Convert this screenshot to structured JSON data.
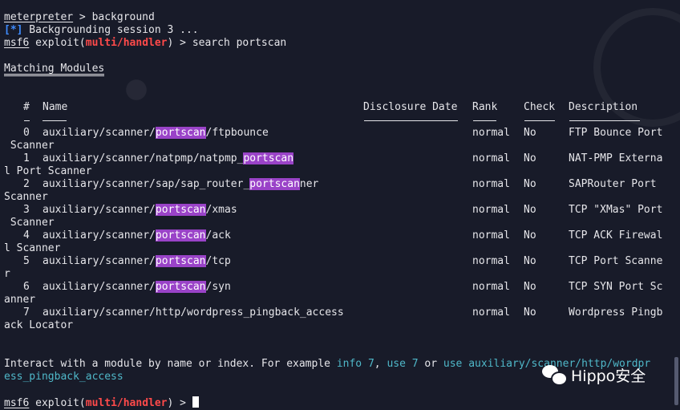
{
  "colors": {
    "background": "#181b29",
    "highlight": "#9a43c8",
    "red": "#ff4a4a",
    "blue": "#3f8cff",
    "cyan": "#4fb8c9"
  },
  "lines": {
    "l1_prompt": "meterpreter",
    "l1_cmd": " > background",
    "l2_marker": "[*]",
    "l2_text": " Backgrounding session 3 ...",
    "l3_prompt": "msf6",
    "l3_a": " exploit(",
    "l3_module": "multi/handler",
    "l3_b": ") > search portscan",
    "matching": "Matching Modules"
  },
  "table": {
    "headers": {
      "num": "#",
      "name": "Name",
      "date": "Disclosure Date",
      "rank": "Rank",
      "check": "Check",
      "desc": "Description"
    },
    "rows": [
      {
        "num": "0",
        "pre": "auxiliary/scanner/",
        "hl": "portscan",
        "post": "/ftpbounce",
        "rank": "normal",
        "check": "No",
        "desc": "FTP Bounce Port",
        "wrap": " Scanner"
      },
      {
        "num": "1",
        "pre": "auxiliary/scanner/natpmp/natpmp_",
        "hl": "portscan",
        "post": "",
        "rank": "normal",
        "check": "No",
        "desc": "NAT-PMP Externa",
        "wrap": "l Port Scanner"
      },
      {
        "num": "2",
        "pre": "auxiliary/scanner/sap/sap_router_",
        "hl": "portscan",
        "post": "ner",
        "rank": "normal",
        "check": "No",
        "desc": "SAPRouter Port",
        "wrap": "Scanner"
      },
      {
        "num": "3",
        "pre": "auxiliary/scanner/",
        "hl": "portscan",
        "post": "/xmas",
        "rank": "normal",
        "check": "No",
        "desc": "TCP \"XMas\" Port",
        "wrap": " Scanner"
      },
      {
        "num": "4",
        "pre": "auxiliary/scanner/",
        "hl": "portscan",
        "post": "/ack",
        "rank": "normal",
        "check": "No",
        "desc": "TCP ACK Firewal",
        "wrap": "l Scanner"
      },
      {
        "num": "5",
        "pre": "auxiliary/scanner/",
        "hl": "portscan",
        "post": "/tcp",
        "rank": "normal",
        "check": "No",
        "desc": "TCP Port Scanne",
        "wrap": "r"
      },
      {
        "num": "6",
        "pre": "auxiliary/scanner/",
        "hl": "portscan",
        "post": "/syn",
        "rank": "normal",
        "check": "No",
        "desc": "TCP SYN Port Sc",
        "wrap": "anner"
      },
      {
        "num": "7",
        "pre": "auxiliary/scanner/http/wordpress_pingback_access",
        "hl": "",
        "post": "",
        "rank": "normal",
        "check": "No",
        "desc": "Wordpress Pingb",
        "wrap": "ack Locator"
      }
    ]
  },
  "footer": {
    "interact_a": "Interact with a module by name or index. For example ",
    "info7": "info 7",
    "comma": ", ",
    "use7": "use 7",
    "or": " or ",
    "use_full_1": "use auxiliary/scanner/http/wordpr",
    "use_full_2": "ess_pingback_access",
    "prompt": "msf6",
    "prompt_a": " exploit(",
    "prompt_module": "multi/handler",
    "prompt_b": ") > "
  },
  "watermark": {
    "icon": "wechat-icon",
    "text": "Hippo安全"
  }
}
